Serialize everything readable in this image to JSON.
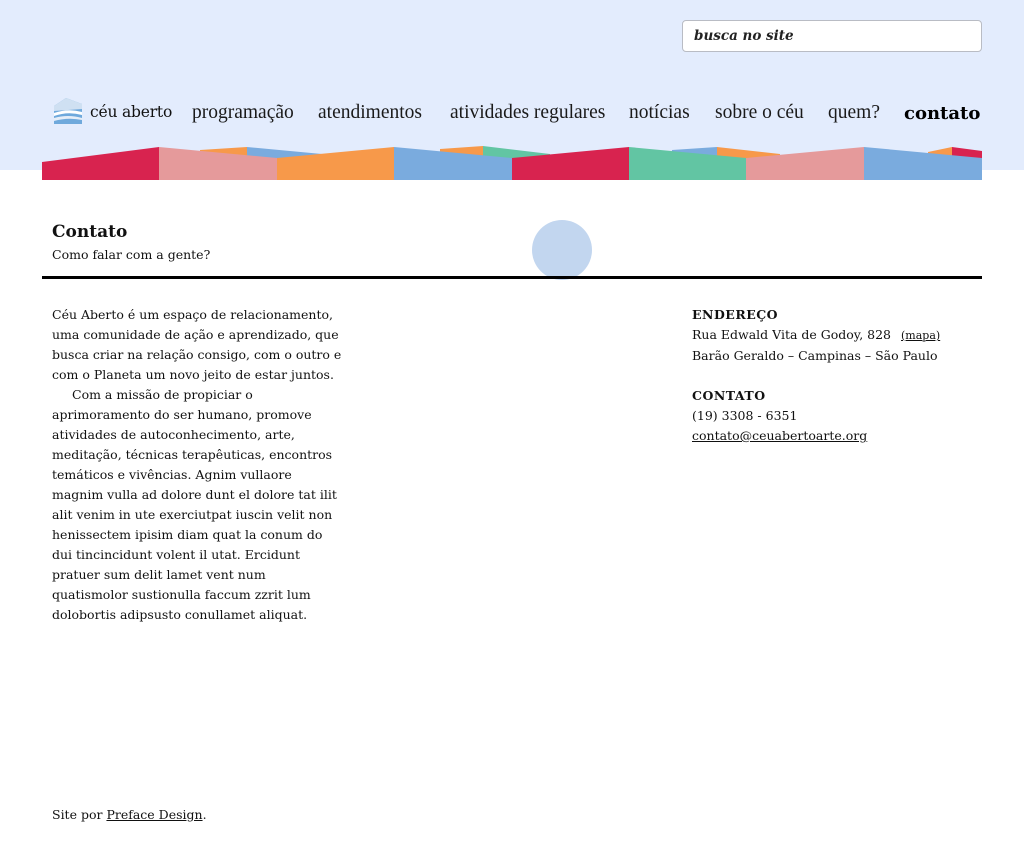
{
  "search": {
    "placeholder": "busca no site"
  },
  "brand": {
    "name": "céu aberto",
    "logo_icon": "sky-logo-icon"
  },
  "nav": {
    "items": [
      {
        "label": "programação"
      },
      {
        "label": "atendimentos"
      },
      {
        "label": "atividades regulares"
      },
      {
        "label": "notícias"
      },
      {
        "label": "sobre o céu"
      },
      {
        "label": "quem?"
      },
      {
        "label": "contato",
        "active": true
      }
    ]
  },
  "colors": {
    "header_bg": "#e3ecfd",
    "red": "#d8234f",
    "pink": "#e59a9b",
    "orange": "#f7994a",
    "blue": "#7aabde",
    "green": "#62c5a3",
    "circle": "#c2d6ef"
  },
  "page": {
    "title": "Contato",
    "subtitle": "Como falar com a gente?"
  },
  "intro": {
    "paragraph1": "Céu Aberto é um espaço de relacionamento, uma comunidade de ação e aprendizado, que busca criar na relação consigo, com o outro e com o Planeta um novo jeito de estar juntos.",
    "paragraph2": "Com a missão de propiciar o aprimoramento do ser humano, promove atividades de autoconhecimento, arte, meditação, técnicas terapêuticas, encontros temáticos e vivências. Agnim vullaore magnim vulla ad dolore dunt el dolore tat ilit alit venim in ute exerciutpat iuscin velit non henissectem ipisim diam quat la conum do dui tincincidunt volent il utat. Ercidunt pratuer sum delit lamet vent num quatismolor sustionulla faccum zzrit lum dolobortis adipsusto conullamet aliquat."
  },
  "address": {
    "heading": "ENDEREÇO",
    "street": "Rua Edwald Vita de Godoy, 828",
    "map_link": "(mapa)",
    "city": "Barão Geraldo – Campinas – São Paulo"
  },
  "contact": {
    "heading": "CONTATO",
    "phone": "(19) 3308 - 6351",
    "email": "contato@ceuabertoarte.org"
  },
  "footer": {
    "prefix": "Site por ",
    "link": "Preface Design",
    "suffix": "."
  }
}
